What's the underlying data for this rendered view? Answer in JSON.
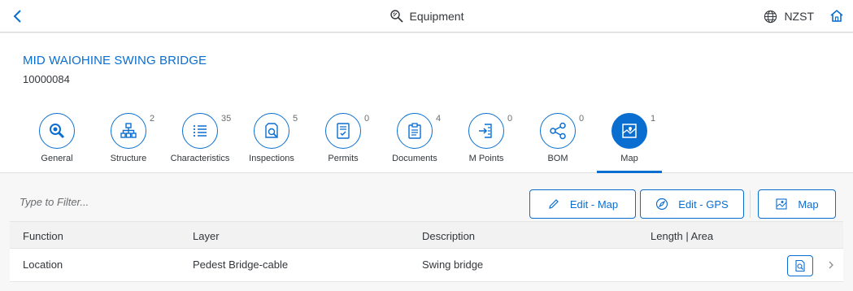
{
  "shell": {
    "title": "Equipment",
    "title_icon": "equipment-search-icon",
    "region": "NZST",
    "back_icon": "back-arrow-icon",
    "region_icon": "globe-icon",
    "home_icon": "home-icon"
  },
  "header": {
    "title": "MID WAIOHINE SWING BRIDGE",
    "id": "10000084"
  },
  "tabs": [
    {
      "label": "General",
      "count": "",
      "icon": "general-icon",
      "selected": false
    },
    {
      "label": "Structure",
      "count": "2",
      "icon": "hierarchy-icon",
      "selected": false
    },
    {
      "label": "Characteristics",
      "count": "35",
      "icon": "list-icon",
      "selected": false
    },
    {
      "label": "Inspections",
      "count": "5",
      "icon": "inspection-icon",
      "selected": false
    },
    {
      "label": "Permits",
      "count": "0",
      "icon": "permit-icon",
      "selected": false
    },
    {
      "label": "Documents",
      "count": "4",
      "icon": "clipboard-icon",
      "selected": false
    },
    {
      "label": "M Points",
      "count": "0",
      "icon": "measuring-point-icon",
      "selected": false
    },
    {
      "label": "BOM",
      "count": "0",
      "icon": "share-icon",
      "selected": false
    },
    {
      "label": "Map",
      "count": "1",
      "icon": "map-icon",
      "selected": true
    }
  ],
  "toolbar": {
    "filter_placeholder": "Type to Filter...",
    "edit_map": "Edit - Map",
    "edit_gps": "Edit - GPS",
    "map": "Map"
  },
  "table": {
    "columns": [
      "Function",
      "Layer",
      "Description",
      "Length | Area"
    ],
    "rows": [
      {
        "function": "Location",
        "layer": "Pedest Bridge-cable",
        "description": "Swing bridge",
        "length_area": ""
      }
    ]
  },
  "colors": {
    "brand": "#0a6ed1",
    "text": "#32363a",
    "muted": "#6a6d70",
    "background": "#f7f7f7"
  }
}
